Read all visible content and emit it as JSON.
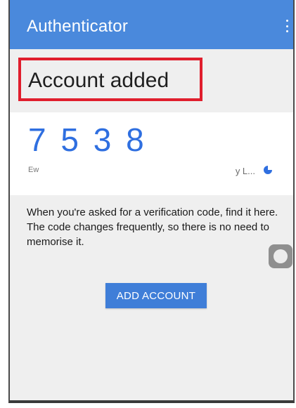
{
  "app": {
    "title": "Authenticator",
    "menu_icon": "more-vert-icon"
  },
  "toast": {
    "text": "Account added",
    "highlight_color": "#e01e2d"
  },
  "account": {
    "code": "7 5 3 8",
    "issuer": "Ew",
    "name": "y L...",
    "timer_icon": "countdown-pie-icon"
  },
  "info": {
    "text": "When you're asked for a verification code, find it here. The code changes frequently, so there is no need to memorise it."
  },
  "actions": {
    "add_account_label": "ADD ACCOUNT"
  },
  "floating": {
    "icon": "assistive-touch-icon"
  },
  "colors": {
    "app_bar": "#4a89dc",
    "code": "#2f6fe0",
    "button": "#3f7ed8"
  }
}
